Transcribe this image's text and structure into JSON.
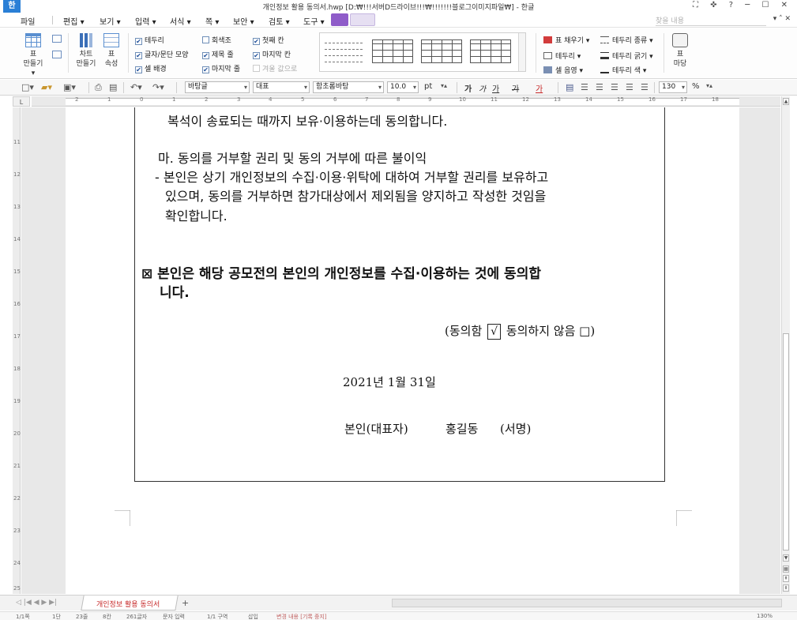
{
  "window": {
    "logo": "한",
    "title": "개인정보 활용 동의서.hwp [D:₩!!!서버D드라이브!!!₩!!!!!!!블로그이미지파일₩] - 한글",
    "controls": "⛶ ✜ ?  ─ ☐ ✕"
  },
  "menu": {
    "items": [
      "파일",
      "편집 ▾",
      "보기 ▾",
      "입력 ▾",
      "서식 ▾",
      "쪽 ▾",
      "보안 ▾",
      "검토 ▾",
      "도구 ▾"
    ],
    "search_placeholder": "찾을 내용",
    "ribbon_controls": "▾ ˄ ✕"
  },
  "ribbon": {
    "table_label": "표",
    "table_label2": "만들기▾",
    "chart_label": "차트",
    "chart_label2": "만들기",
    "tprop_label": "표",
    "tprop_label2": "속성",
    "checks": [
      {
        "label": "테두리",
        "checked": true
      },
      {
        "label": "글자/문단 모양",
        "checked": true
      },
      {
        "label": "셀 배경",
        "checked": true
      },
      {
        "label": "회색조",
        "checked": false
      },
      {
        "label": "제목 줄",
        "checked": true
      },
      {
        "label": "마지막 줄",
        "checked": true
      },
      {
        "label": "첫째 칸",
        "checked": true
      },
      {
        "label": "마지막 칸",
        "checked": true
      },
      {
        "label": "겨울 값으로",
        "checked": false
      }
    ],
    "right_items": [
      "표 채우기 ▾",
      "테두리 종류 ▾",
      "테두리 ▾",
      "테두리 굵기 ▾",
      "셀 음영 ▾",
      "테두리 색 ▾"
    ],
    "madang_label": "표",
    "madang_label2": "마당"
  },
  "format": {
    "style": "바탕글",
    "style_represent": "대표",
    "font": "함초롬바탕",
    "size": "10.0",
    "unit": "pt",
    "bold": "가",
    "italic": "가",
    "underline": "가",
    "strike": "가",
    "color": "가",
    "zoom": "130",
    "zoom_unit": "%"
  },
  "ruler": {
    "corner": "L",
    "h_numbers": [
      "2",
      "1",
      "0",
      "1",
      "2",
      "3",
      "4",
      "5",
      "6",
      "7",
      "8",
      "9",
      "10",
      "11",
      "12",
      "13",
      "14",
      "15",
      "16",
      "17",
      "18"
    ],
    "v_numbers": [
      "11",
      "12",
      "13",
      "14",
      "15",
      "16",
      "17",
      "18",
      "19",
      "20",
      "21",
      "22",
      "23",
      "24",
      "25"
    ]
  },
  "document": {
    "line1": "복석이 송료되는 때까지 보유·이용하는데 동의합니다.",
    "line2": "마. 동의를 거부할 권리 및 동의 거부에 따른 불이익",
    "line3": "- 본인은 상기 개인정보의 수집·이용·위탁에 대하여 거부할 권리를 보유하고",
    "line4": "있으며, 동의를 거부하면 참가대상에서 제외됨을 양지하고 작성한 것임을",
    "line5": "확인합니다.",
    "consent_line1": "⊠ 본인은 해당 공모전의 본인의 개인정보를 수집·이용하는 것에    동의합",
    "consent_line2": "니다.",
    "agree_open": "(동의함",
    "agree_check": "√",
    "agree_rest": "동의하지 않음 □)",
    "date": "2021년  1월  31일",
    "signer_label": "본인(대표자)",
    "signer_name": "홍길동",
    "sign": "(서명)"
  },
  "tabs": {
    "nav": "◁ |◀ ◀ ▶ ▶|",
    "doc_tab": "개인정보 활용 동의서",
    "add": "+"
  },
  "status": {
    "items": [
      "1/1쪽",
      "1단",
      "23줄",
      "8칸",
      "261글자",
      "문자 입력",
      "1/1 구역",
      "삽입",
      "변경 내용 [기록 중지]"
    ],
    "zoom": "130%"
  }
}
